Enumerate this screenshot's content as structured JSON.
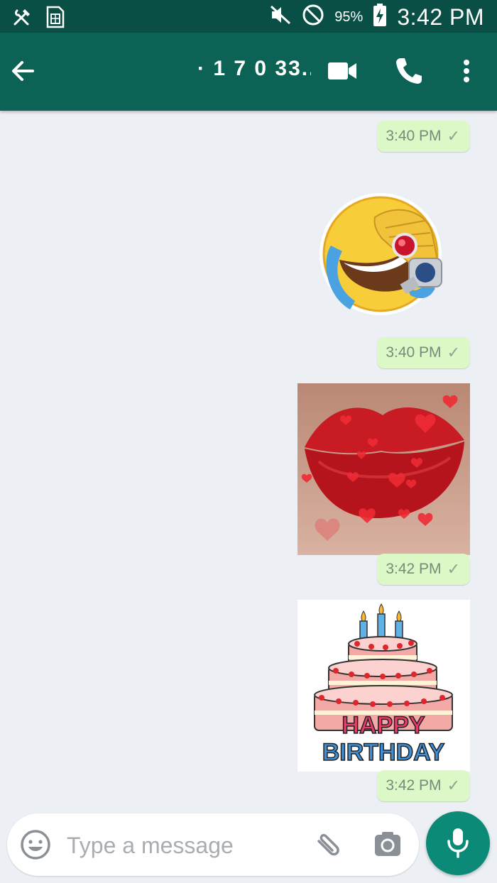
{
  "status_bar": {
    "battery_percent": "95%",
    "time": "3:42 PM",
    "icons": [
      "tools-icon",
      "sim-card-icon",
      "mute-icon",
      "do-not-disturb-icon",
      "battery-charging-icon"
    ]
  },
  "header": {
    "contact_name": "· 1 7 0 33...",
    "icons": [
      "back-arrow-icon",
      "video-call-icon",
      "phone-icon",
      "more-vert-icon"
    ]
  },
  "messages": [
    {
      "type": "status",
      "time": "3:40 PM"
    },
    {
      "type": "sticker",
      "sticker": "laughing-emoji-sticker",
      "time": "3:40 PM"
    },
    {
      "type": "sticker",
      "sticker": "red-lips-hearts-sticker",
      "time": "3:42 PM"
    },
    {
      "type": "sticker",
      "sticker": "birthday-cake-sticker",
      "time": "3:42 PM",
      "text": "HAPPY BIRTHDAY"
    }
  ],
  "sticker_text": {
    "happy": "HAPPY",
    "birthday": "BIRTHDAY"
  },
  "input": {
    "placeholder": "Type a message",
    "value": ""
  },
  "colors": {
    "status_bar": "#0a4f45",
    "app_bar": "#0d6256",
    "chat_background": "#ecf0f5",
    "outgoing_bubble": "#dcf8c6",
    "mic_button": "#0a8a77"
  }
}
